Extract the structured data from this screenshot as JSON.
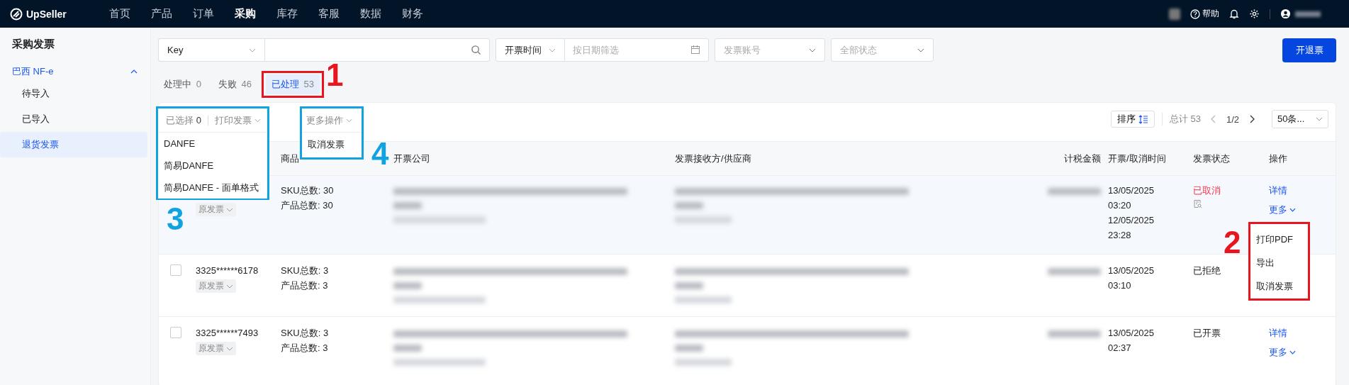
{
  "topbar": {
    "logo": "UpSeller",
    "nav": [
      {
        "label": "首页",
        "selected": false
      },
      {
        "label": "产品",
        "selected": false
      },
      {
        "label": "订单",
        "selected": false
      },
      {
        "label": "采购",
        "selected": true
      },
      {
        "label": "库存",
        "selected": false
      },
      {
        "label": "客服",
        "selected": false
      },
      {
        "label": "数据",
        "selected": false
      },
      {
        "label": "财务",
        "selected": false
      }
    ],
    "help": "帮助"
  },
  "sidebar": {
    "title": "采购发票",
    "group": {
      "label": "巴西 NF-e",
      "expanded": true,
      "items": [
        {
          "label": "待导入",
          "selected": false
        },
        {
          "label": "已导入",
          "selected": false
        },
        {
          "label": "退货发票",
          "selected": true
        }
      ]
    }
  },
  "filters": {
    "key_select": "Key",
    "date_type": "开票时间",
    "date": {
      "placeholder": "按日期筛选"
    },
    "account": {
      "placeholder": "发票账号"
    },
    "status": {
      "placeholder": "全部状态"
    },
    "primary_button": "开退票"
  },
  "tabs": [
    {
      "label": "处理中",
      "count": "0",
      "selected": false
    },
    {
      "label": "失败",
      "count": "46",
      "selected": false
    },
    {
      "label": "已处理",
      "count": "53",
      "selected": true
    }
  ],
  "toolbar": {
    "selected_label": "已选择",
    "selected_count": "0",
    "print": "打印发票",
    "more": "更多操作",
    "sort": "排序",
    "total": "总计 53",
    "page": "1/2",
    "page_size": "50条..."
  },
  "print_menu": [
    "DANFE",
    "简易DANFE",
    "简易DANFE - 面单格式"
  ],
  "more_menu": [
    "取消发票"
  ],
  "table": {
    "columns": [
      "商品",
      "开票公司",
      "发票接收方/供应商",
      "计税金额",
      "开票/取消时间",
      "发票状态",
      "操作"
    ],
    "rows": [
      {
        "tag": "原发票",
        "sku": "SKU总数: 30",
        "products": "产品总数: 30",
        "times": [
          "13/05/2025",
          "03:20",
          "12/05/2025",
          "23:28"
        ],
        "status": "已取消",
        "kind": "cancelled",
        "actions": [
          "详情",
          "更多"
        ]
      },
      {
        "checked": false,
        "number": "3325******6178",
        "tag": "原发票",
        "sku": "SKU总数: 3",
        "products": "产品总数: 3",
        "times": [
          "13/05/2025",
          "03:10"
        ],
        "status": "已拒绝",
        "kind": "normal",
        "actions": []
      },
      {
        "checked": false,
        "number": "3325******7493",
        "tag": "原发票",
        "sku": "SKU总数: 3",
        "products": "产品总数: 3",
        "times": [
          "13/05/2025",
          "02:37"
        ],
        "status": "已开票",
        "kind": "normal",
        "actions": [
          "详情",
          "更多"
        ]
      }
    ]
  },
  "row_menu": [
    "打印PDF",
    "导出",
    "取消发票"
  ],
  "callouts": [
    {
      "label": "1",
      "color": "#e8141e"
    },
    {
      "label": "2",
      "color": "#e8141e"
    },
    {
      "label": "3",
      "color": "#11a3e0"
    },
    {
      "label": "4",
      "color": "#11a3e0"
    }
  ]
}
